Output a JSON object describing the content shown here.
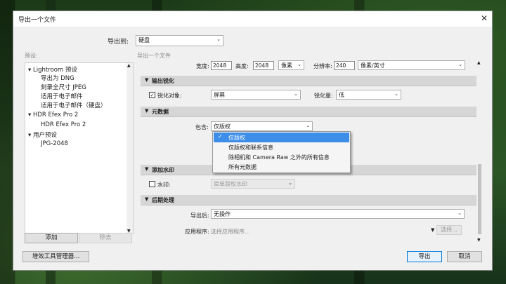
{
  "window": {
    "title": "导出一个文件",
    "close_glyph": "✕"
  },
  "export_to": {
    "label": "导出到:",
    "value": "硬盘"
  },
  "presets": {
    "header": "预设:",
    "items": [
      {
        "label": "Lightroom 预设",
        "level": 0,
        "expanded": true
      },
      {
        "label": "导出为 DNG",
        "level": 1
      },
      {
        "label": "刻录全尺寸 JPEG",
        "level": 1
      },
      {
        "label": "适用于电子邮件",
        "level": 1
      },
      {
        "label": "适用于电子邮件（硬盘）",
        "level": 1
      },
      {
        "label": "HDR Efex Pro 2",
        "level": 0,
        "expanded": true
      },
      {
        "label": "HDR Efex Pro 2",
        "level": 1
      },
      {
        "label": "用户预设",
        "level": 0,
        "expanded": true
      },
      {
        "label": "JPG-2048",
        "level": 1
      }
    ],
    "add_button": "添加",
    "remove_button": "移去"
  },
  "right": {
    "subtitle": "导出一个文件",
    "size_row": {
      "width_label": "宽度:",
      "width_value": "2048",
      "height_label": "高度:",
      "height_value": "2048",
      "unit": "像素",
      "res_label": "分辨率:",
      "res_value": "240",
      "res_unit": "像素/英寸"
    },
    "sharpen": {
      "title": "输出锐化",
      "checkbox_label": "锐化对象:",
      "checked": true,
      "target_value": "屏幕",
      "amount_label": "锐化量:",
      "amount_value": "低"
    },
    "metadata": {
      "title": "元数据",
      "include_label": "包含:",
      "include_value": "仅版权",
      "options": [
        "仅版权",
        "仅版权和联系信息",
        "除相机和 Camera Raw 之外的所有信息",
        "所有元数据"
      ],
      "selected_index": 0
    },
    "watermark": {
      "title": "添加水印",
      "checkbox_label": "水印:",
      "checked": false,
      "value": "简单版权水印"
    },
    "post": {
      "title": "后期处理",
      "after_label": "导出后:",
      "after_value": "无操作",
      "app_label": "应用程序:",
      "app_placeholder": "选择应用程序...",
      "choose_button": "选择..."
    }
  },
  "footer": {
    "plugin_manager": "增效工具管理器...",
    "export_button": "导出",
    "cancel_button": "取消"
  }
}
